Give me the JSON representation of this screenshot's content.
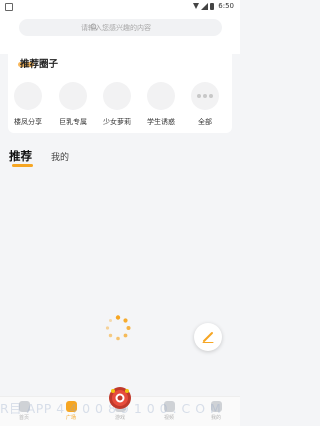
{
  "status_bar": {
    "time": "6:50"
  },
  "search": {
    "placeholder": "请输入您感兴趣的内容"
  },
  "circles": {
    "title": "推荐圈子",
    "items": [
      {
        "label": "楼凤分享"
      },
      {
        "label": "巨乳专属"
      },
      {
        "label": "少女萝莉"
      },
      {
        "label": "学生诱惑"
      },
      {
        "label": "全部"
      }
    ]
  },
  "tabs": {
    "recommend": "推荐",
    "mine": "我的"
  },
  "bottom_nav": {
    "items": [
      {
        "label": "首页",
        "icon": "home-icon"
      },
      {
        "label": "广场",
        "icon": "square-icon",
        "active": true
      },
      {
        "label": "游戏",
        "icon": "game-icon"
      },
      {
        "label": "视频",
        "icon": "video-icon"
      },
      {
        "label": "我的",
        "icon": "profile-icon"
      }
    ]
  },
  "watermark": "R目 APP 4 4 0 0 8 9 1 0 0 . C O M",
  "colors": {
    "accent": "#f6a623",
    "background": "#f4f5f7"
  }
}
